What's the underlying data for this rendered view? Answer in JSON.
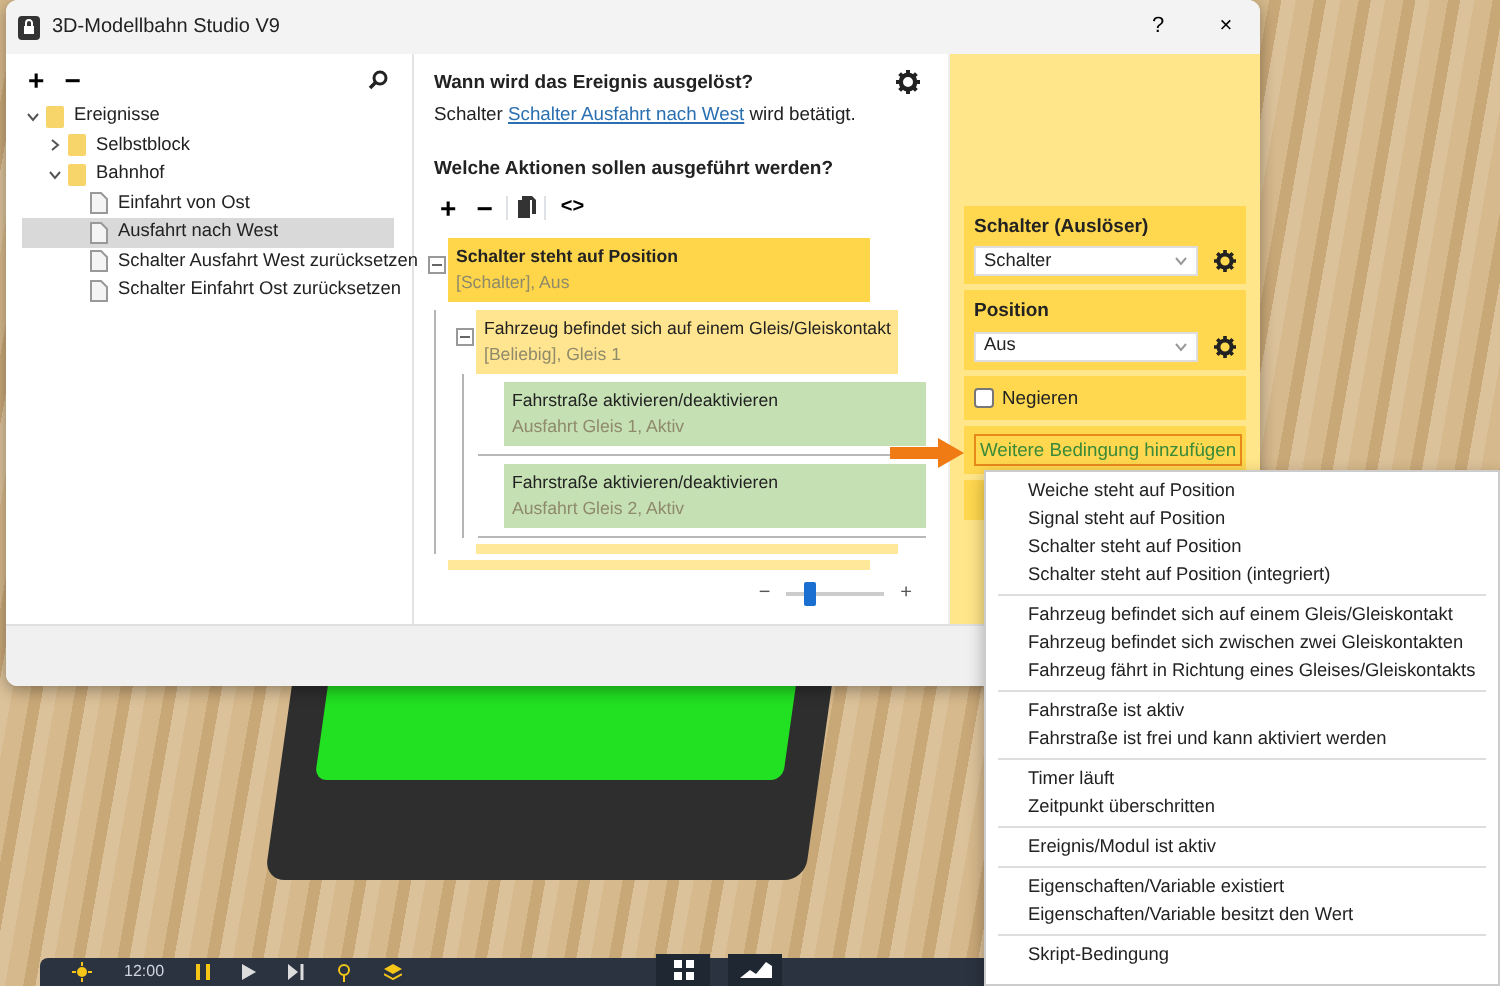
{
  "window": {
    "title": "3D-Modellbahn Studio V9",
    "help": "?",
    "close": "×"
  },
  "tree_toolbar": {
    "add": "+",
    "remove": "−"
  },
  "tree": [
    {
      "label": "Ereignisse",
      "kind": "folder",
      "expanded": true,
      "selected": false,
      "children": [
        {
          "label": "Selbstblock",
          "kind": "folder",
          "expanded": false,
          "selected": false
        },
        {
          "label": "Bahnhof",
          "kind": "folder",
          "expanded": true,
          "selected": false,
          "children": [
            {
              "label": "Einfahrt von Ost",
              "kind": "file",
              "selected": false
            },
            {
              "label": "Ausfahrt nach West",
              "kind": "file",
              "selected": true
            },
            {
              "label": "Schalter Ausfahrt West zurücksetzen",
              "kind": "file",
              "selected": false
            },
            {
              "label": "Schalter Einfahrt Ost zurücksetzen",
              "kind": "file",
              "selected": false
            }
          ]
        }
      ]
    }
  ],
  "trigger": {
    "heading": "Wann wird das Ereignis ausgelöst?",
    "text_before": "Schalter",
    "link": "Schalter Ausfahrt nach West",
    "text_after": "wird betätigt."
  },
  "actions": {
    "heading": "Welche Aktionen sollen ausgeführt werden?",
    "add": "+",
    "remove": "−",
    "code": "<>"
  },
  "blocks": [
    {
      "kind": "condition",
      "title": "Schalter steht auf Position",
      "detail": "[Schalter], Aus",
      "selected": true,
      "expanded": true,
      "children": [
        {
          "kind": "condition",
          "title": "Fahrzeug befindet sich auf einem Gleis/Gleiskontakt",
          "detail": "[Beliebig], Gleis 1",
          "selected": false,
          "expanded": true,
          "children": [
            {
              "kind": "action",
              "title": "Fahrstraße aktivieren/deaktivieren",
              "detail": "Ausfahrt Gleis 1, Aktiv",
              "selected": false
            },
            {
              "kind": "action",
              "title": "Fahrstraße aktivieren/deaktivieren",
              "detail": "Ausfahrt Gleis 2, Aktiv",
              "selected": false
            }
          ]
        }
      ]
    }
  ],
  "zoom_slider": {
    "minus": "−",
    "plus": "+",
    "level": 0.2
  },
  "properties": [
    {
      "kind": "select",
      "label": "Schalter (Auslöser)",
      "value": "Schalter"
    },
    {
      "kind": "select",
      "label": "Position",
      "value": "Aus"
    },
    {
      "kind": "checkbox",
      "label": "Negieren",
      "checked": false
    },
    {
      "kind": "link",
      "label": "Weitere Bedingung hinzufügen"
    }
  ],
  "menu": {
    "groups": [
      [
        "Weiche steht auf Position",
        "Signal steht auf Position",
        "Schalter steht auf Position",
        "Schalter steht auf Position (integriert)"
      ],
      [
        "Fahrzeug befindet sich auf einem Gleis/Gleiskontakt",
        "Fahrzeug befindet sich zwischen zwei Gleiskontakten",
        "Fahrzeug fährt in Richtung eines Gleises/Gleiskontakts"
      ],
      [
        "Fahrstraße ist aktiv",
        "Fahrstraße ist frei und kann aktiviert werden"
      ],
      [
        "Timer läuft",
        "Zeitpunkt überschritten"
      ],
      [
        "Ereignis/Modul ist aktiv"
      ],
      [
        "Eigenschaften/Variable existiert",
        "Eigenschaften/Variable besitzt den Wert"
      ],
      [
        "Skript-Bedingung"
      ]
    ]
  },
  "taskbar": {
    "time": "12:00"
  }
}
